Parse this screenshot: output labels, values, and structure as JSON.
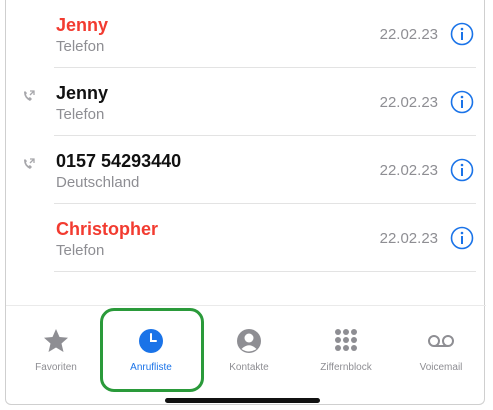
{
  "calls": [
    {
      "name": "Jenny",
      "type": "Telefon",
      "date": "22.02.23",
      "missed": true,
      "outgoing": false
    },
    {
      "name": "Jenny",
      "type": "Telefon",
      "date": "22.02.23",
      "missed": false,
      "outgoing": true
    },
    {
      "name": "0157 54293440",
      "type": "Deutschland",
      "date": "22.02.23",
      "missed": false,
      "outgoing": true
    },
    {
      "name": "Christopher",
      "type": "Telefon",
      "date": "22.02.23",
      "missed": true,
      "outgoing": false
    }
  ],
  "tabbar": {
    "items": [
      {
        "label": "Favoriten",
        "icon": "star-icon"
      },
      {
        "label": "Anrufliste",
        "icon": "clock-icon",
        "active": true
      },
      {
        "label": "Kontakte",
        "icon": "person-icon"
      },
      {
        "label": "Ziffernblock",
        "icon": "keypad-icon"
      },
      {
        "label": "Voicemail",
        "icon": "voicemail-icon"
      }
    ]
  },
  "colors": {
    "missed": "#f23b30",
    "accent": "#1a73e8",
    "highlight": "#2a9a3a"
  }
}
